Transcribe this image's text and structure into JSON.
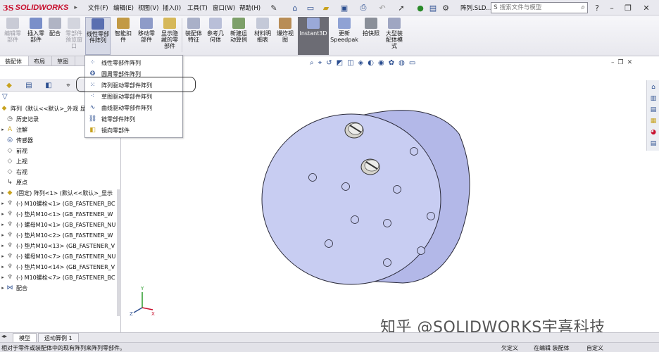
{
  "app": {
    "logo_ds": "3S",
    "logo_name": "SOLIDWORKS",
    "doc_title": "阵列.SLD...",
    "menus": [
      "文件(F)",
      "编辑(E)",
      "视图(V)",
      "插入(I)",
      "工具(T)",
      "窗口(W)",
      "帮助(H)"
    ],
    "search_placeholder": "搜索文件与模型",
    "search_glyph": "S"
  },
  "ribbon": {
    "buttons": [
      {
        "label": "编辑零\n部件",
        "icon": "edit-component-icon",
        "disabled": true
      },
      {
        "label": "插入零\n部件",
        "icon": "insert-component-icon",
        "disabled": false
      },
      {
        "label": "配合",
        "icon": "mate-icon",
        "disabled": false
      },
      {
        "label": "零部件\n预览窗\n口",
        "icon": "component-preview-icon",
        "disabled": true
      },
      {
        "label": "线性零部\n件阵列",
        "icon": "linear-pattern-icon",
        "disabled": false,
        "selected": true
      },
      {
        "label": "智能扣\n件",
        "icon": "smart-fastener-icon",
        "disabled": false
      },
      {
        "label": "移动零\n部件",
        "icon": "move-component-icon",
        "disabled": false
      },
      {
        "label": "显示隐\n藏的零\n部件",
        "icon": "show-hidden-icon",
        "disabled": false
      },
      {
        "label": "装配体\n特征",
        "icon": "assembly-feature-icon",
        "disabled": false
      },
      {
        "label": "参考几\n何体",
        "icon": "reference-geometry-icon",
        "disabled": false
      },
      {
        "label": "新建运\n动算例",
        "icon": "new-motion-study-icon",
        "disabled": false
      },
      {
        "label": "材料明\n细表",
        "icon": "bom-icon",
        "disabled": false
      },
      {
        "label": "爆炸视\n图",
        "icon": "exploded-view-icon",
        "disabled": false
      },
      {
        "label": "Instant3D",
        "icon": "instant3d-icon",
        "disabled": false,
        "dark": true
      },
      {
        "label": "更新\nSpeedpak",
        "icon": "speedpak-icon",
        "disabled": false
      },
      {
        "label": "拍快照",
        "icon": "snapshot-icon",
        "disabled": false
      },
      {
        "label": "大型装\n配体模\n式",
        "icon": "large-assembly-icon",
        "disabled": false
      }
    ]
  },
  "tabs": [
    "装配体",
    "布局",
    "草图"
  ],
  "dropdown": {
    "items": [
      {
        "label": "线性零部件阵列",
        "icon": "linear-pattern-icon"
      },
      {
        "label": "圆周零部件阵列",
        "icon": "circular-pattern-icon"
      },
      {
        "label": "阵列驱动零部件阵列",
        "icon": "pattern-driven-icon",
        "highlighted": true
      },
      {
        "label": "草图驱动零部件阵列",
        "icon": "sketch-driven-icon"
      },
      {
        "label": "曲线驱动零部件阵列",
        "icon": "curve-driven-icon"
      },
      {
        "label": "链零部件阵列",
        "icon": "chain-pattern-icon"
      },
      {
        "label": "镜向零部件",
        "icon": "mirror-component-icon"
      }
    ]
  },
  "tree": {
    "root": "阵列（默认<<默认>_外观 显",
    "items": [
      {
        "label": "历史记录",
        "icon": "history-icon",
        "expand": ""
      },
      {
        "label": "注解",
        "icon": "annotation-icon",
        "expand": "▸"
      },
      {
        "label": "传感器",
        "icon": "sensor-icon",
        "expand": ""
      },
      {
        "label": "前视",
        "icon": "plane-icon",
        "expand": ""
      },
      {
        "label": "上视",
        "icon": "plane-icon",
        "expand": ""
      },
      {
        "label": "右视",
        "icon": "plane-icon",
        "expand": ""
      },
      {
        "label": "原点",
        "icon": "origin-icon",
        "expand": ""
      },
      {
        "label": "(固定) 阵列<1> (默认<<默认>_显示",
        "icon": "part-icon",
        "expand": "▸"
      },
      {
        "label": "(-) M10螺栓<1> (GB_FASTENER_BC",
        "icon": "fastener-icon",
        "expand": "▸"
      },
      {
        "label": "(-) 垫片M10<1> (GB_FASTENER_W",
        "icon": "fastener-icon",
        "expand": "▸"
      },
      {
        "label": "(-) 螺母M10<1> (GB_FASTENER_NU",
        "icon": "fastener-icon",
        "expand": "▸"
      },
      {
        "label": "(-) 垫片M10<2> (GB_FASTENER_W",
        "icon": "fastener-icon",
        "expand": "▸"
      },
      {
        "label": "(-) 垫片M10<13> (GB_FASTENER_V",
        "icon": "fastener-icon",
        "expand": "▸"
      },
      {
        "label": "(-) 螺母M10<7> (GB_FASTENER_NU",
        "icon": "fastener-icon",
        "expand": "▸"
      },
      {
        "label": "(-) 垫片M10<14> (GB_FASTENER_V",
        "icon": "fastener-icon",
        "expand": "▸"
      },
      {
        "label": "(-) M10螺栓<7> (GB_FASTENER_BC",
        "icon": "fastener-icon",
        "expand": "▸"
      },
      {
        "label": "配合",
        "icon": "mate-icon",
        "expand": "▸"
      }
    ]
  },
  "viewport": {
    "watermark": "知乎 @SOLIDWORKS宇喜科技",
    "triad": {
      "x": "X",
      "y": "Y",
      "z": "Z"
    }
  },
  "bottom_tabs": [
    "模型",
    "运动算例 1"
  ],
  "status": {
    "message": "相对于零件或装配体中的现有阵列来阵列零部件。",
    "defined": "欠定义",
    "mode": "在编辑 装配体",
    "custom": "自定义"
  },
  "colors": {
    "part_face": "#c8cdf2",
    "part_edge": "#2b2b3a",
    "part_side": "#b1b6e6",
    "accent": "#2a4d8f",
    "logo_red": "#c8102e"
  }
}
